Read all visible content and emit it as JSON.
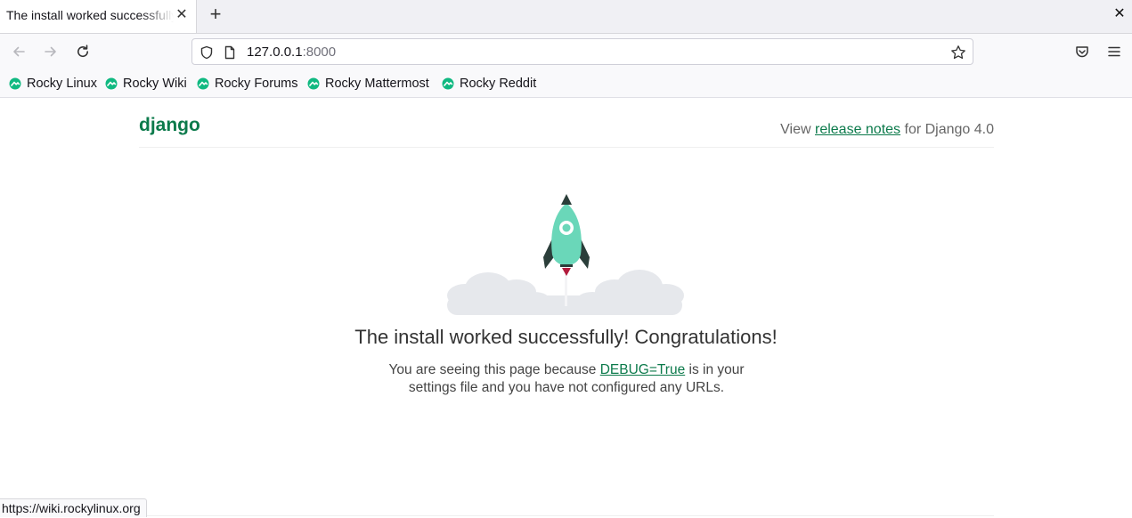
{
  "browser": {
    "tab": {
      "title": "The install worked successfully! Congratulations!",
      "close_glyph": "✕"
    },
    "new_tab_glyph": "+",
    "window_close_glyph": "✕",
    "url": {
      "host": "127.0.0.1",
      "port": ":8000"
    },
    "bookmarks": [
      {
        "label": "Rocky Linux"
      },
      {
        "label": "Rocky Wiki"
      },
      {
        "label": "Rocky Forums"
      },
      {
        "label": "Rocky Mattermost"
      },
      {
        "label": "Rocky Reddit"
      }
    ],
    "status_url": "https://wiki.rockylinux.org",
    "accent": "#10b981"
  },
  "page": {
    "logo": "django",
    "release": {
      "prefix": "View ",
      "link": "release notes",
      "suffix": " for Django 4.0"
    },
    "headline": "The install worked successfully! Congratulations!",
    "desc": {
      "before": "You are seeing this page because ",
      "link": "DEBUG=True",
      "after": " is in your settings file and you have not configured any URLs."
    },
    "colors": {
      "brand": "#0c7a4b",
      "rocket": "#6ad7b9",
      "rocket_dark": "#2b3e3a",
      "flame": "#b21b3c",
      "cloud": "#e6e8ec"
    }
  }
}
